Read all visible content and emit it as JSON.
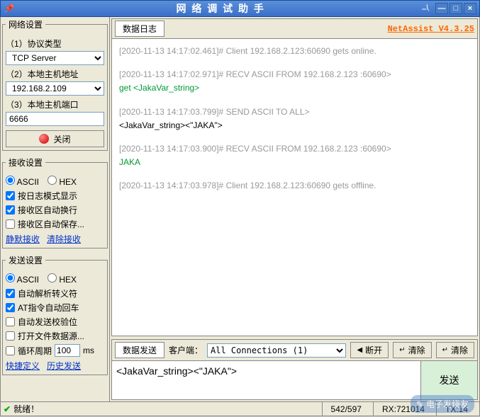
{
  "titlebar": {
    "title": "网 络 调 试 助 手",
    "min": "—",
    "max": "□",
    "close": "×"
  },
  "network_settings": {
    "legend": "网络设置",
    "proto_label": "（1）协议类型",
    "proto_value": "TCP Server",
    "host_label": "（2）本地主机地址",
    "host_value": "192.168.2.109",
    "port_label": "（3）本地主机端口",
    "port_value": "6666",
    "close_btn": "关闭"
  },
  "recv_settings": {
    "legend": "接收设置",
    "ascii": "ASCII",
    "hex": "HEX",
    "opt1": "按日志模式显示",
    "opt2": "接收区自动换行",
    "opt3": "接收区自动保存...",
    "link1": "静默接收",
    "link2": "清除接收"
  },
  "send_settings": {
    "legend": "发送设置",
    "ascii": "ASCII",
    "hex": "HEX",
    "opt1": "自动解析转义符",
    "opt2": "AT指令自动回车",
    "opt3": "自动发送校验位",
    "opt4": "打开文件数据源...",
    "cycle_label": "循环周期",
    "cycle_value": "100",
    "cycle_unit": "ms",
    "link1": "快捷定义",
    "link2": "历史发送"
  },
  "log": {
    "tab": "数据日志",
    "brand": "NetAssist V4.3.25",
    "entries": [
      {
        "ts": "[2020-11-13 14:17:02.461]# Client 192.168.2.123:60690 gets online.",
        "body": "",
        "cls": ""
      },
      {
        "ts": "[2020-11-13 14:17:02.971]# RECV ASCII FROM 192.168.2.123 :60690>",
        "body": "get <JakaVar_string>",
        "cls": "log-green"
      },
      {
        "ts": "[2020-11-13 14:17:03.799]# SEND ASCII TO ALL>",
        "body": "<JakaVar_string><\"JAKA\">",
        "cls": "log-black"
      },
      {
        "ts": "[2020-11-13 14:17:03.900]# RECV ASCII FROM 192.168.2.123 :60690>",
        "body": "JAKA",
        "cls": "log-green"
      },
      {
        "ts": "[2020-11-13 14:17:03.978]# Client 192.168.2.123:60690 gets offline.",
        "body": "",
        "cls": ""
      }
    ]
  },
  "send_area": {
    "tab": "数据发送",
    "client_label": "客户端：",
    "combo": "All Connections (1)",
    "disconnect": "断开",
    "clear": "清除",
    "clear2": "清除",
    "input": "<JakaVar_string><\"JAKA\">",
    "send_btn": "发送"
  },
  "status": {
    "ready": "就绪！",
    "count": "542/597",
    "rx": "RX:721014",
    "tx": "TX:14"
  },
  "watermark": "电子发烧友"
}
